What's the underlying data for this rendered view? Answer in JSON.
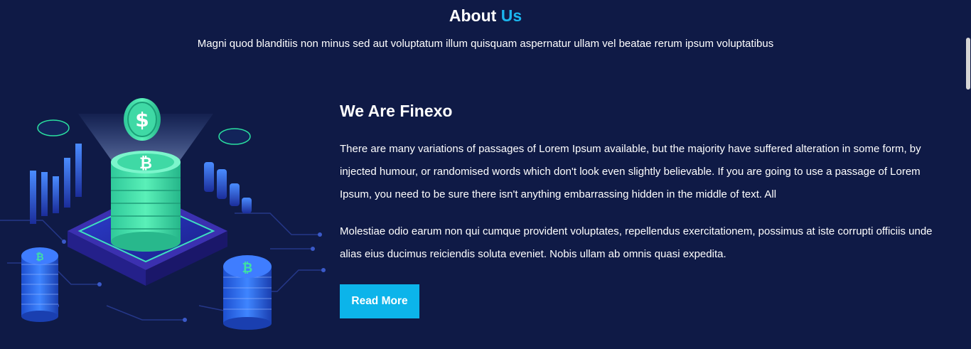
{
  "section": {
    "title_part1": "About",
    "title_part2": "Us",
    "subtitle": "Magni quod blanditiis non minus sed aut voluptatum illum quisquam aspernatur ullam vel beatae rerum ipsum voluptatibus"
  },
  "content": {
    "heading": "We Are Finexo",
    "paragraph1": "There are many variations of passages of Lorem Ipsum available, but the majority have suffered alteration in some form, by injected humour, or randomised words which don't look even slightly believable. If you are going to use a passage of Lorem Ipsum, you need to be sure there isn't anything embarrassing hidden in the middle of text. All",
    "paragraph2": "Molestiae odio earum non qui cumque provident voluptates, repellendus exercitationem, possimus at iste corrupti officiis unde alias eius ducimus reiciendis soluta eveniet. Nobis ullam ab omnis quasi expedita.",
    "button_label": "Read More"
  },
  "illustration": {
    "icon": "crypto-coin-stack-icon",
    "coin_symbol": "₿"
  },
  "colors": {
    "background": "#0f1a46",
    "accent": "#1bb6ef",
    "button": "#0cb4ea",
    "coin_green": "#3ee0a5",
    "coin_blue": "#2a6af0"
  }
}
